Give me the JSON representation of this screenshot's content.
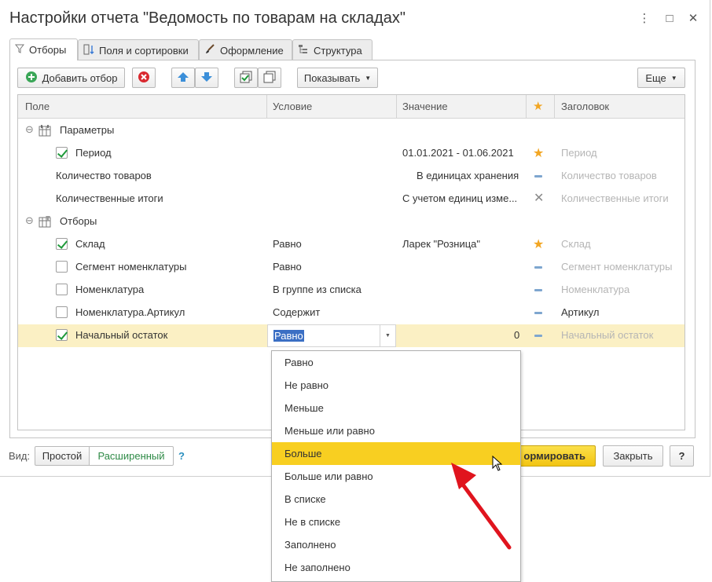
{
  "window": {
    "title": "Настройки отчета \"Ведомость по товарам на складах\"",
    "controls": [
      "⋮",
      "□",
      "✕"
    ]
  },
  "tabs": [
    {
      "label": "Отборы",
      "icon": "filter-icon"
    },
    {
      "label": "Поля и сортировки",
      "icon": "fields-sort-icon"
    },
    {
      "label": "Оформление",
      "icon": "brush-icon"
    },
    {
      "label": "Структура",
      "icon": "structure-icon"
    }
  ],
  "toolbar": {
    "add_filter": "Добавить отбор",
    "show": "Показывать",
    "more": "Еще"
  },
  "columns": {
    "field": "Поле",
    "condition": "Условие",
    "value": "Значение",
    "star": "★",
    "caption": "Заголовок"
  },
  "rows": [
    {
      "field": "Параметры",
      "condition": "",
      "value": "",
      "caption": ""
    },
    {
      "field": "Период",
      "condition": "",
      "value": "01.01.2021 - 01.06.2021",
      "caption": "Период"
    },
    {
      "field": "Количество товаров",
      "condition": "",
      "value": "В единицах хранения",
      "caption": "Количество товаров"
    },
    {
      "field": "Количественные итоги",
      "condition": "",
      "value": "С учетом единиц изме...",
      "caption": "Количественные итоги"
    },
    {
      "field": "Отборы",
      "condition": "",
      "value": "",
      "caption": ""
    },
    {
      "field": "Склад",
      "condition": "Равно",
      "value": "Ларек \"Розница\"",
      "caption": "Склад"
    },
    {
      "field": "Сегмент номенклатуры",
      "condition": "Равно",
      "value": "",
      "caption": "Сегмент номенклатуры"
    },
    {
      "field": "Номенклатура",
      "condition": "В группе из списка",
      "value": "",
      "caption": "Номенклатура"
    },
    {
      "field": "Номенклатура.Артикул",
      "condition": "Содержит",
      "value": "",
      "caption": "Артикул"
    },
    {
      "field": "Начальный остаток",
      "condition": "Равно",
      "value": "0",
      "caption": "Начальный остаток"
    }
  ],
  "dropdown": {
    "options": [
      "Равно",
      "Не равно",
      "Меньше",
      "Меньше или равно",
      "Больше",
      "Больше или равно",
      "В списке",
      "Не в списке",
      "Заполнено",
      "Не заполнено"
    ],
    "highlighted": "Больше"
  },
  "footer": {
    "view_label": "Вид:",
    "simple": "Простой",
    "extended": "Расширенный",
    "help": "?",
    "generate": "Сформировать",
    "generate_visible": "ормировать",
    "close": "Закрыть",
    "help_button": "?"
  },
  "colors": {
    "accent_yellow": "#f8cf21",
    "selected_row": "#fbf0c4",
    "star": "#f2a623",
    "check": "#1f9a3a",
    "arrow": "#e0141e"
  }
}
